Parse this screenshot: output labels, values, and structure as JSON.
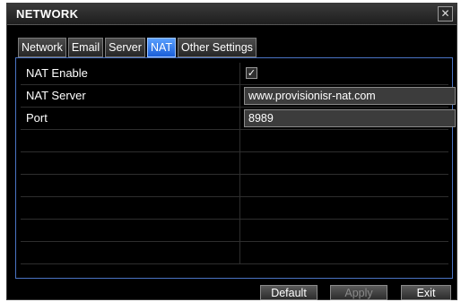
{
  "window": {
    "title": "NETWORK",
    "close_glyph": "✕"
  },
  "tabs": [
    {
      "label": "Network"
    },
    {
      "label": "Email"
    },
    {
      "label": "Server"
    },
    {
      "label": "NAT",
      "active": true
    },
    {
      "label": "Other Settings"
    }
  ],
  "nat": {
    "enable_label": "NAT Enable",
    "enable_checked": true,
    "server_label": "NAT Server",
    "server_value": "www.provisionisr-nat.com",
    "port_label": "Port",
    "port_value": "8989"
  },
  "buttons": {
    "default_label": "Default",
    "apply_label": "Apply",
    "exit_label": "Exit"
  },
  "colors": {
    "active_tab": "#1a5ed8",
    "panel_border": "#4a74c4"
  }
}
